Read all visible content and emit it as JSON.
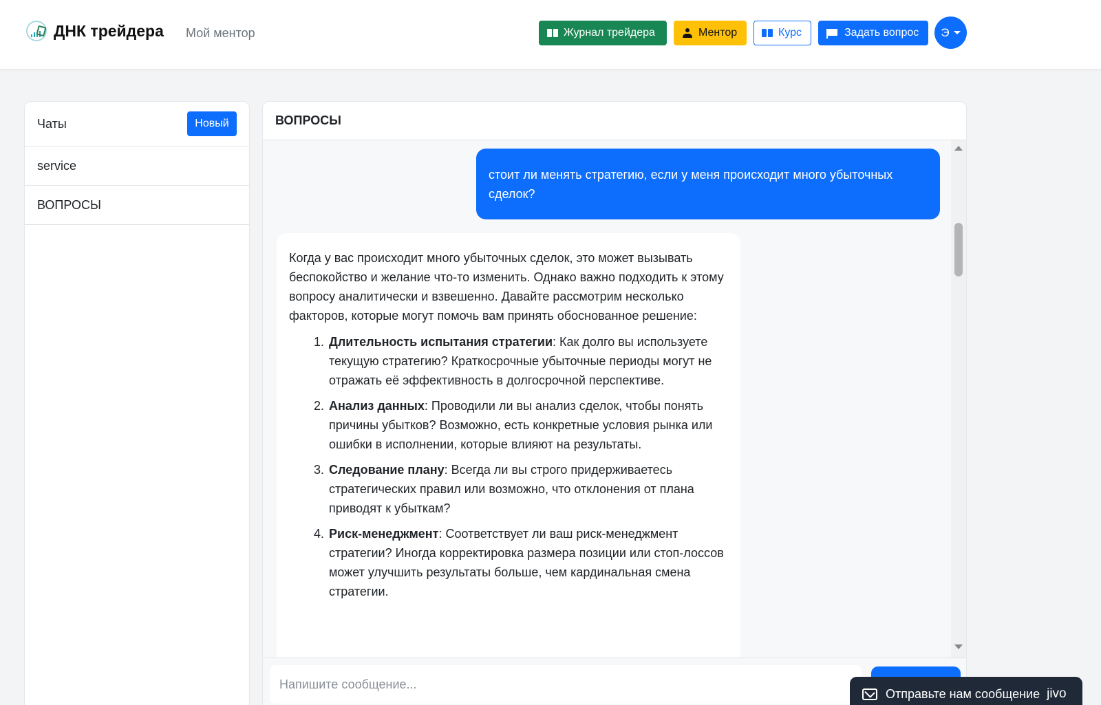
{
  "header": {
    "brand": "ДНК трейдера",
    "nav_mentor": "Мой ментор",
    "buttons": {
      "journal": "Журнал трейдера",
      "mentor": "Ментор",
      "course": "Курс",
      "ask": "Задать вопрос"
    },
    "avatar_initial": "Э"
  },
  "sidebar": {
    "title": "Чаты",
    "new_button": "Новый",
    "chats": [
      {
        "label": "service"
      },
      {
        "label": "ВОПРОСЫ"
      }
    ]
  },
  "chat": {
    "title": "ВОПРОСЫ",
    "user_message": "стоит ли менять стратегию, если у меня происходит много убыточных сделок?",
    "bot_intro": "Когда у вас происходит много убыточных сделок, это может вызывать беспокойство и желание что-то изменить. Однако важно подходить к этому вопросу аналитически и взвешенно. Давайте рассмотрим несколько факторов, которые могут помочь вам принять обоснованное решение:",
    "bot_points": [
      {
        "title": "Длительность испытания стратегии",
        "text": ": Как долго вы используете текущую стратегию? Краткосрочные убыточные периоды могут не отражать её эффективность в долгосрочной перспективе."
      },
      {
        "title": "Анализ данных",
        "text": ": Проводили ли вы анализ сделок, чтобы понять причины убытков? Возможно, есть конкретные условия рынка или ошибки в исполнении, которые влияют на результаты."
      },
      {
        "title": "Следование плану",
        "text": ": Всегда ли вы строго придерживаетесь стратегических правил или возможно, что отклонения от плана приводят к убыткам?"
      },
      {
        "title": "Риск-менеджмент",
        "text": ": Соответствует ли ваш риск-менеджмент стратегии? Иногда корректировка размера позиции или стоп-лоссов может улучшить результаты больше, чем кардинальная смена стратегии."
      }
    ],
    "input_placeholder": "Напишите сообщение..."
  },
  "jivo": {
    "label": "Отправьте нам сообщение",
    "brand": "jivo"
  },
  "colors": {
    "primary": "#0d6efd",
    "success": "#198754",
    "warning": "#ffc107",
    "dark_widget": "#1f2937"
  },
  "icons": [
    "logo-icon",
    "book-icon",
    "person-icon",
    "flag-icon",
    "chevron-down-icon",
    "mail-icon"
  ]
}
